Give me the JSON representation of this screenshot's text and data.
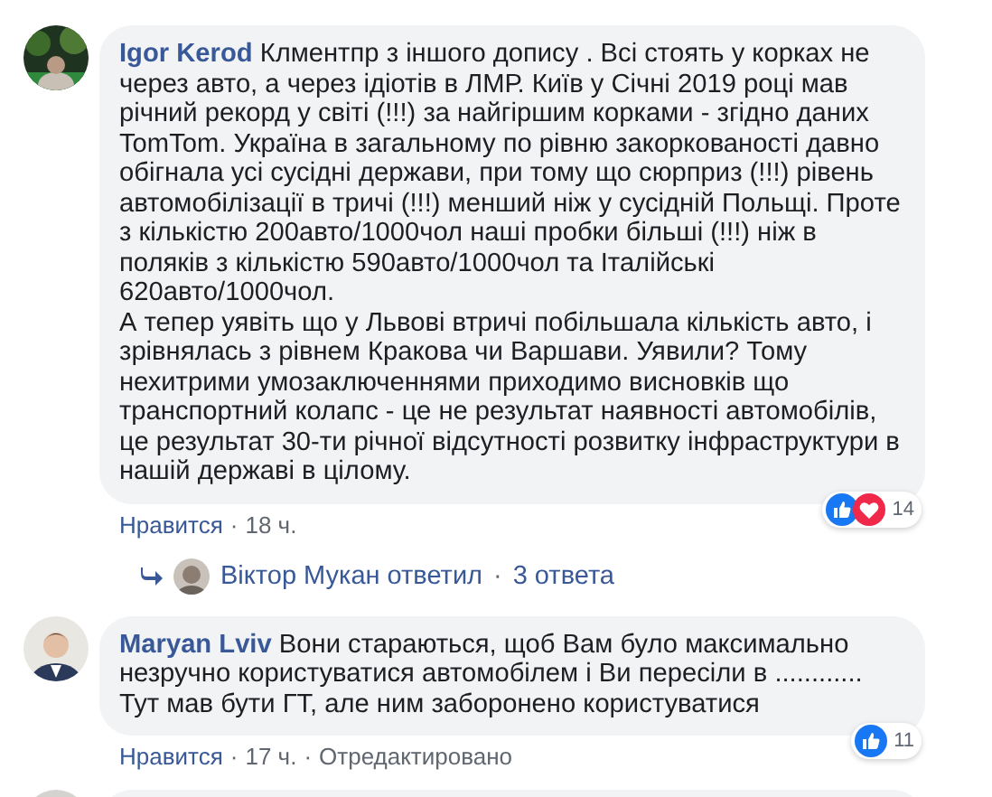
{
  "comments": [
    {
      "kind": "full",
      "author": "Igor Kerod",
      "text": "Клментпр з іншого допису . Всі стоять у корках не через авто, а через ідіотів в ЛМР. Київ у Січні 2019 році мав річний рекорд у світі (!!!) за найгіршим корками - згідно даних TomTom. Україна в загальному по рівню закоркованості давно обігнала усі сусідні держави, при тому що сюрприз (!!!) рівень автомобілізації в тричі (!!!) менший ніж у сусідній Польщі. Проте з кількістю 200авто/1000чол наші пробки більші (!!!) ніж в поляків з кількістю 590авто/1000чол та Італійські 620авто/1000чол.\nА тепер уявіть що у Львові втричі побільшала кількість авто, і зрівнялась з рівнем Кракова чи Варшави. Уявили? Тому нехитрими умозаключеннями приходимо висновків що транспортний колапс - це не результат наявності автомобілів, це результат 30-ти річної відсутності розвитку інфраструктури в нашій державі в цілому.",
      "reactions": {
        "icons": [
          {
            "kind": "like"
          },
          {
            "kind": "love"
          }
        ],
        "count": "14"
      },
      "meta": [
        {
          "kind": "link",
          "text": "Нравится"
        },
        {
          "kind": "sep",
          "text": "·"
        },
        {
          "kind": "plain",
          "text": "18 ч."
        }
      ],
      "replies": {
        "author_line": "Віктор Мукан ответил",
        "sep": "·",
        "count": "3 ответа"
      }
    },
    {
      "kind": "full",
      "author": "Maryan Lviv",
      "text": "Вони стараються, щоб Вам було максимально незручно користуватися автомобілем і Ви пересіли в ............ Тут мав бути ГТ, але ним заборонено користуватися",
      "reactions": {
        "icons": [
          {
            "kind": "like"
          }
        ],
        "count": "11"
      },
      "meta": [
        {
          "kind": "link",
          "text": "Нравится"
        },
        {
          "kind": "sep",
          "text": "·"
        },
        {
          "kind": "plain",
          "text": "17 ч."
        },
        {
          "kind": "sep",
          "text": "·"
        },
        {
          "kind": "plain",
          "text": "Отредактировано"
        }
      ]
    },
    {
      "kind": "cut"
    }
  ]
}
